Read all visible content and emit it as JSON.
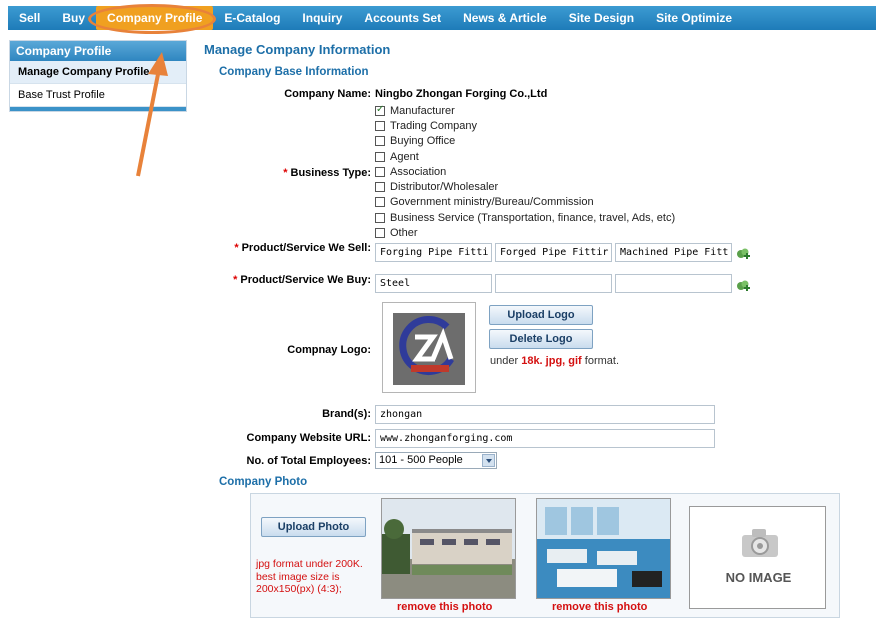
{
  "nav": {
    "items": [
      {
        "label": "Sell"
      },
      {
        "label": "Buy"
      },
      {
        "label": "Company Profile",
        "active": true
      },
      {
        "label": "E-Catalog"
      },
      {
        "label": "Inquiry"
      },
      {
        "label": "Accounts Set"
      },
      {
        "label": "News & Article"
      },
      {
        "label": "Site Design"
      },
      {
        "label": "Site Optimize"
      }
    ]
  },
  "sidebar": {
    "title": "Company Profile",
    "items": [
      {
        "label": "Manage Company Profile"
      },
      {
        "label": "Base Trust Profile"
      }
    ]
  },
  "main": {
    "title": "Manage Company Information",
    "base_section": "Company Base Information",
    "company_name_label": "Company Name:",
    "company_name": "Ningbo Zhongan Forging Co.,Ltd",
    "business_type_label": "Business Type:",
    "business_types": [
      {
        "label": "Manufacturer",
        "checked": true
      },
      {
        "label": "Trading Company",
        "checked": false
      },
      {
        "label": "Buying Office",
        "checked": false
      },
      {
        "label": "Agent",
        "checked": false
      },
      {
        "label": "Association",
        "checked": false
      },
      {
        "label": "Distributor/Wholesaler",
        "checked": false
      },
      {
        "label": "Government ministry/Bureau/Commission",
        "checked": false
      },
      {
        "label": "Business Service (Transportation, finance, travel, Ads, etc)",
        "checked": false
      },
      {
        "label": "Other",
        "checked": false
      }
    ],
    "sell_label": "Product/Service We Sell:",
    "sell_values": [
      "Forging Pipe Fitti",
      "Forged Pipe Fittir",
      "Machined Pipe Fitt"
    ],
    "buy_label": "Product/Service We Buy:",
    "buy_values": [
      "Steel",
      "",
      ""
    ],
    "logo_label": "Compnay Logo:",
    "upload_logo": "Upload Logo",
    "delete_logo": "Delete Logo",
    "logo_note_prefix": "under",
    "logo_note_highlight": "18k. jpg, gif",
    "logo_note_suffix": "format.",
    "brand_label": "Brand(s):",
    "brand_value": "zhongan",
    "url_label": "Company Website URL:",
    "url_value": "www.zhonganforging.com",
    "employees_label": "No. of Total Employees:",
    "employees_value": "101 - 500 People",
    "photo_section": "Company Photo",
    "upload_photo": "Upload Photo",
    "photo_note": "jpg format under 200K. best image size is 200x150(px) (4:3);",
    "remove_photo_1": "remove this photo",
    "remove_photo_2": "remove this photo",
    "no_image": "NO IMAGE"
  },
  "colors": {
    "nav_bg": "#2a8ac6",
    "active_tab": "#f0a020",
    "annotation": "#e8823a",
    "required": "#d00000",
    "title_blue": "#1d6fa8"
  }
}
